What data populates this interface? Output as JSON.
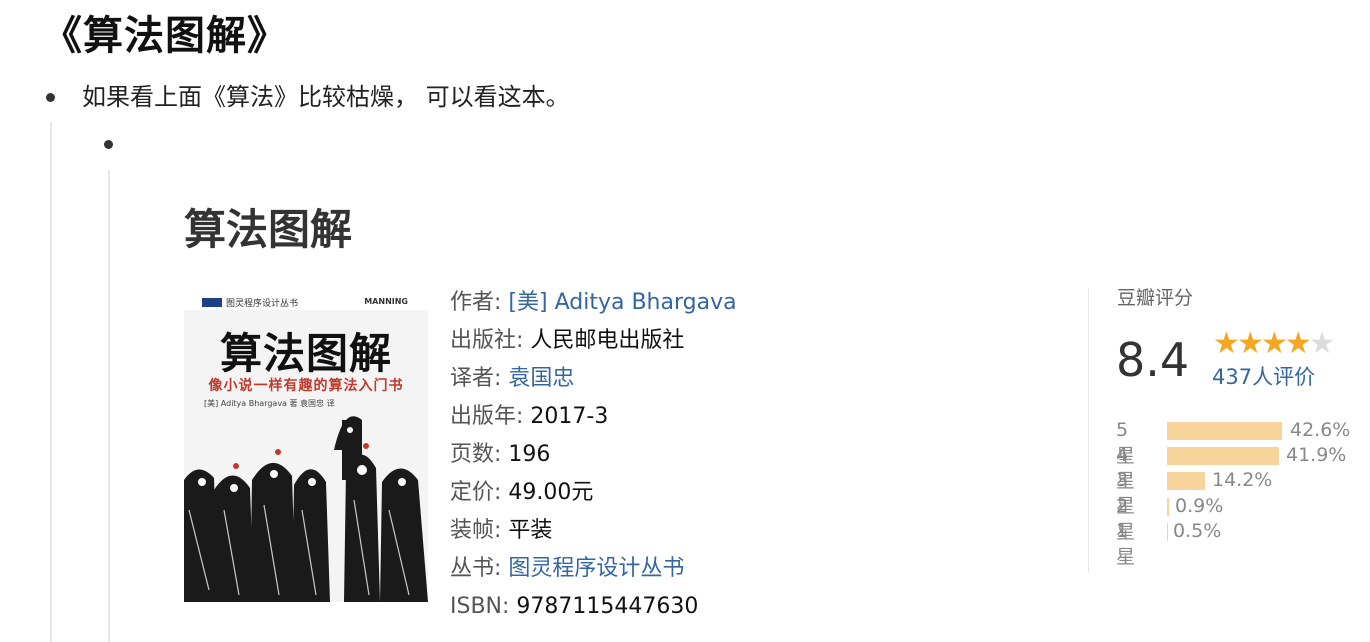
{
  "heading": "《算法图解》",
  "bullet1": "如果看上面《算法》比较枯燥， 可以看这本。",
  "book": {
    "title": "算法图解",
    "cover": {
      "series": "图灵程序设计丛书",
      "publisher_mark": "MANNING",
      "title": "算法图解",
      "subtitle": "像小说一样有趣的算法入门书",
      "author_line": "[美] Aditya Bhargava 著  袁国忠 译"
    },
    "info": {
      "author_label": "作者:",
      "author": "[美] Aditya Bhargava",
      "publisher_label": "出版社:",
      "publisher": "人民邮电出版社",
      "translator_label": "译者:",
      "translator": "袁国忠",
      "year_label": "出版年:",
      "year": "2017-3",
      "pages_label": "页数:",
      "pages": "196",
      "price_label": "定价:",
      "price": "49.00元",
      "binding_label": "装帧:",
      "binding": "平装",
      "series_label": "丛书:",
      "series": "图灵程序设计丛书",
      "isbn_label": "ISBN:",
      "isbn": "9787115447630"
    }
  },
  "rating": {
    "title": "豆瓣评分",
    "score": "8.4",
    "stars": 4,
    "count": "437人评价",
    "distribution": [
      {
        "label": "5星",
        "percent": "42.6%",
        "value": 42.6
      },
      {
        "label": "4星",
        "percent": "41.9%",
        "value": 41.9
      },
      {
        "label": "3星",
        "percent": "14.2%",
        "value": 14.2
      },
      {
        "label": "2星",
        "percent": "0.9%",
        "value": 0.9
      },
      {
        "label": "1星",
        "percent": "0.5%",
        "value": 0.5
      }
    ],
    "colors": {
      "bar": "#f6d49b",
      "star": "#f5a623",
      "link": "#3366a0"
    }
  }
}
